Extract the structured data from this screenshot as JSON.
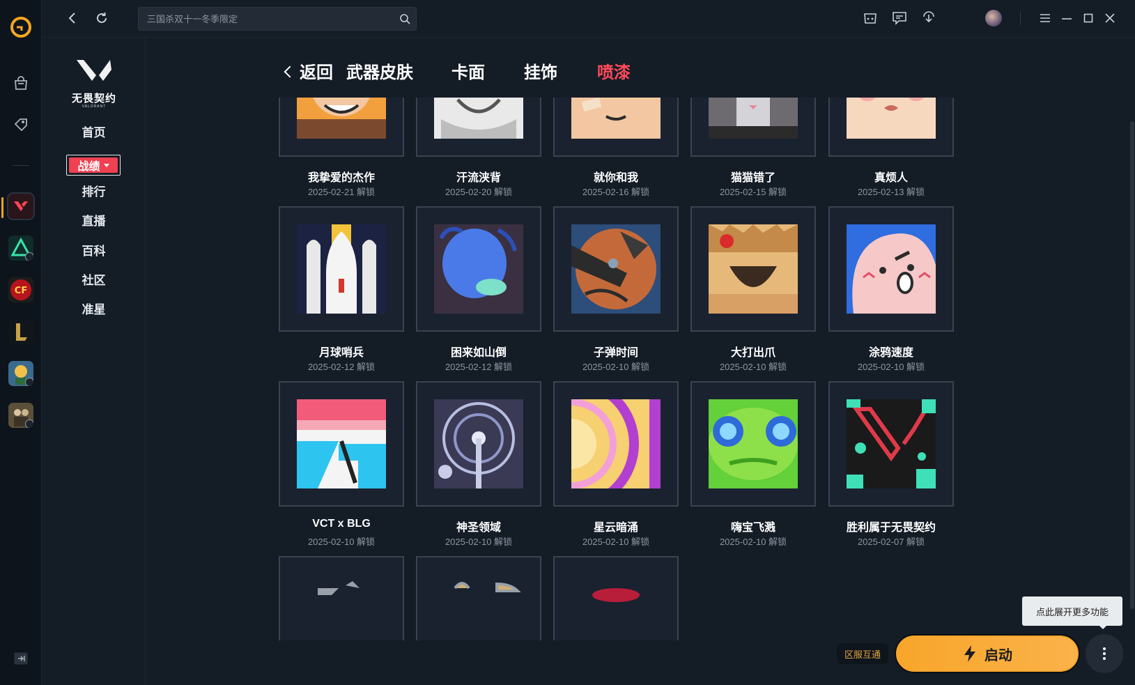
{
  "search": {
    "placeholder": "三国杀双十一冬季限定"
  },
  "game": {
    "logo_text": "无畏契约",
    "logo_sub": "VALORANT"
  },
  "sidebar": {
    "items": [
      {
        "label": "首页"
      },
      {
        "label": "战绩"
      },
      {
        "label": "排行"
      },
      {
        "label": "直播"
      },
      {
        "label": "百科"
      },
      {
        "label": "社区"
      },
      {
        "label": "准星"
      }
    ]
  },
  "tabs": {
    "back_label": "返回",
    "items": [
      {
        "label": "武器皮肤"
      },
      {
        "label": "卡面"
      },
      {
        "label": "挂饰"
      },
      {
        "label": "喷漆"
      }
    ],
    "active": "喷漆"
  },
  "sprays": [
    {
      "name": "我挚爱的杰作",
      "date": "2025-02-21 解锁",
      "art": "nerd"
    },
    {
      "name": "汗流浃背",
      "date": "2025-02-20 解锁",
      "art": "seal"
    },
    {
      "name": "就你和我",
      "date": "2025-02-16 解锁",
      "art": "boy"
    },
    {
      "name": "猫猫错了",
      "date": "2025-02-15 解锁",
      "art": "cat"
    },
    {
      "name": "真烦人",
      "date": "2025-02-13 解锁",
      "art": "face"
    },
    {
      "name": "月球哨兵",
      "date": "2025-02-12 解锁",
      "art": "rocket"
    },
    {
      "name": "困来如山倒",
      "date": "2025-02-12 解锁",
      "art": "blue"
    },
    {
      "name": "子弹时间",
      "date": "2025-02-10 解锁",
      "art": "bullet"
    },
    {
      "name": "大打出爪",
      "date": "2025-02-10 解锁",
      "art": "tiger"
    },
    {
      "name": "涂鸦速度",
      "date": "2025-02-10 解锁",
      "art": "blob"
    },
    {
      "name": "VCT x BLG",
      "date": "2025-02-10 解锁",
      "art": "vct"
    },
    {
      "name": "神圣领域",
      "date": "2025-02-10 解锁",
      "art": "holy"
    },
    {
      "name": "星云暗涌",
      "date": "2025-02-10 解锁",
      "art": "nebula"
    },
    {
      "name": "嗨宝飞溅",
      "date": "2025-02-10 解锁",
      "art": "green"
    },
    {
      "name": "胜利属于无畏契约",
      "date": "2025-02-07 解锁",
      "art": "val"
    }
  ],
  "footer": {
    "region_tag": "区服互通",
    "start_label": "启动",
    "tooltip": "点此展开更多功能"
  },
  "colors": {
    "accent": "#f04052",
    "start": "#f8a62a",
    "active_tab": "#ff4a5a"
  }
}
